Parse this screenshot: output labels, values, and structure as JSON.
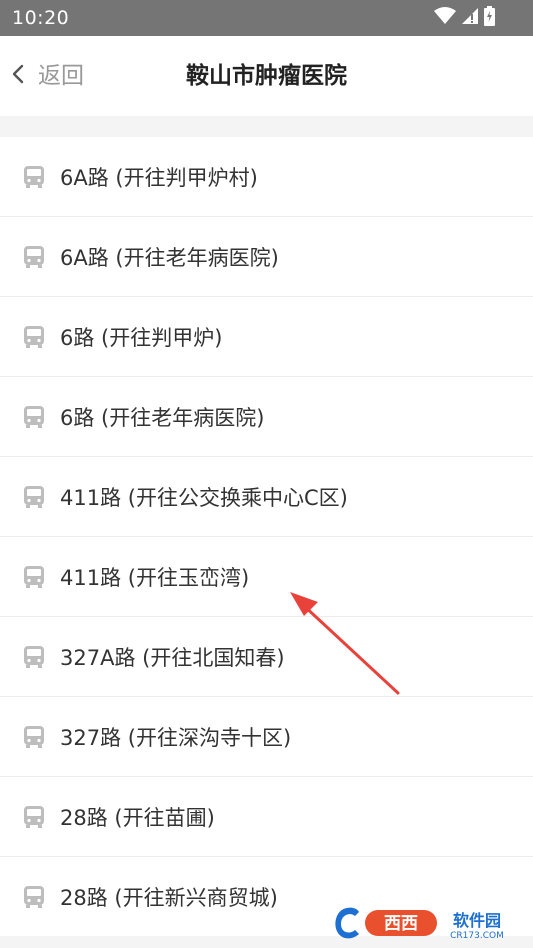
{
  "status_bar": {
    "time": "10:20",
    "icons": [
      "wifi-icon",
      "signal-icon",
      "battery-icon"
    ]
  },
  "header": {
    "back_label": "返回",
    "title": "鞍山市肿瘤医院"
  },
  "routes": [
    {
      "label": "6A路 (开往判甲炉村)"
    },
    {
      "label": "6A路 (开往老年病医院)"
    },
    {
      "label": "6路 (开往判甲炉)"
    },
    {
      "label": "6路 (开往老年病医院)"
    },
    {
      "label": "411路 (开往公交换乘中心C区)"
    },
    {
      "label": "411路 (开往玉峦湾)"
    },
    {
      "label": "327A路 (开往北国知春)"
    },
    {
      "label": "327路 (开往深沟寺十区)"
    },
    {
      "label": "28路 (开往苗圃)"
    },
    {
      "label": "28路 (开往新兴商贸城)"
    }
  ],
  "watermark": {
    "brand": "西西软件园",
    "domain": "CR173.COM"
  },
  "colors": {
    "status_bar": "#757575",
    "header_bg": "#ffffff",
    "page_bg": "#f4f4f4",
    "annotation_arrow": "#e8423b",
    "bus_icon": "#bdbdbd"
  }
}
